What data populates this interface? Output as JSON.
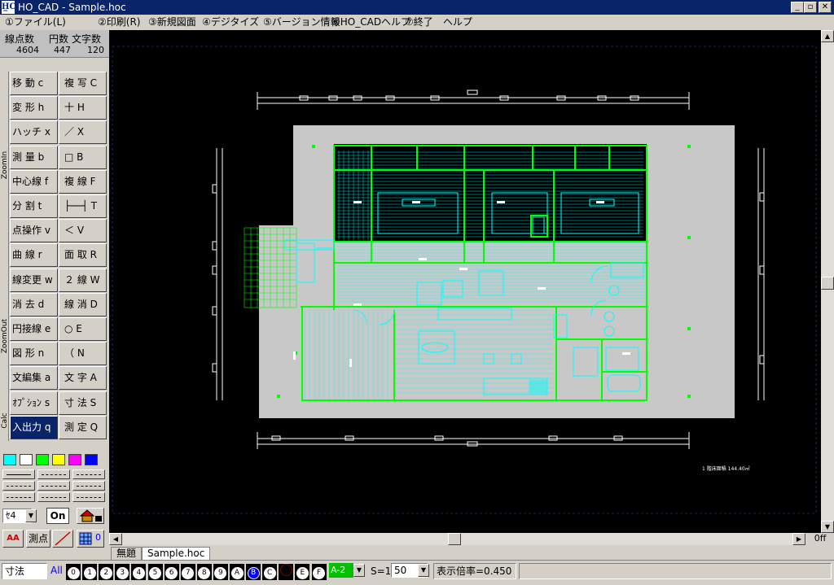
{
  "window": {
    "app_icon_text": "H̲C",
    "title": "HO_CAD - Sample.hoc",
    "min_label": "_",
    "max_label": "▫",
    "close_label": "✕"
  },
  "menu": [
    "①ファイル(L)",
    "②印刷(R)",
    "③新規図面",
    "④デジタイズ",
    "⑤バージョン情報",
    "⑥HO_CADヘルプ",
    "⑦終了",
    "ヘルプ"
  ],
  "stats": {
    "labels": [
      "線点数",
      "円数",
      "文字数"
    ],
    "values": [
      "4604",
      "447",
      "120"
    ]
  },
  "side_tabs": [
    "ZoomIn",
    "ZoomOut",
    "Calc"
  ],
  "commands": [
    [
      "移 動 c",
      "複 写 C"
    ],
    [
      "変 形 h",
      "十 H"
    ],
    [
      "ハッチ x",
      "／ X"
    ],
    [
      "測 量 b",
      "□ B"
    ],
    [
      "中心線 f",
      "複 線 F"
    ],
    [
      "分 割 t",
      "├──┤ T"
    ],
    [
      "点操作 v",
      "＜ V"
    ],
    [
      "曲 線 r",
      "面 取 R"
    ],
    [
      "線変更 w",
      "２ 線 W"
    ],
    [
      "消 去 d",
      "線 消 D"
    ],
    [
      "円接線 e",
      "○ E"
    ],
    [
      "図 形 n",
      "（ N"
    ],
    [
      "文編集 a",
      "文 字 A"
    ],
    [
      "ｵﾌﾟｼｮﾝ s",
      "寸 法 S"
    ],
    [
      "入出力 q",
      "測 定 Q"
    ]
  ],
  "active_command": "入出力 q",
  "palette_colors": [
    "#00ffff",
    "#ffffff",
    "#00ff00",
    "#ffff00",
    "#ff00ff",
    "#0000ff"
  ],
  "tools": {
    "line_type_select": "ｾ4",
    "on_label": "On",
    "sokuten_label": "測点",
    "grid_value": "0",
    "hscroll_right_label": "0ff"
  },
  "doc_tabs": [
    "無題",
    "Sample.hoc"
  ],
  "active_tab": "Sample.hoc",
  "bottom": {
    "input_value": "寸法",
    "all_label": "All",
    "layers": [
      "0",
      "1",
      "2",
      "3",
      "4",
      "5",
      "6",
      "7",
      "8",
      "9",
      "A",
      "B",
      "C",
      "",
      "E",
      "F"
    ],
    "selected_layer": "B",
    "layer_select": "A-2",
    "scale_label": "S=1:",
    "scale_value": "50",
    "zoom_text": "表示倍率=0.450"
  },
  "drawing": {
    "annotation": "1 階床面積 144.40㎡",
    "colors": {
      "background": "#000000",
      "wall": "#00ff00",
      "furniture": "#00ffff",
      "dimension": "#ffffff",
      "sheet": "#c8c8c8"
    }
  }
}
